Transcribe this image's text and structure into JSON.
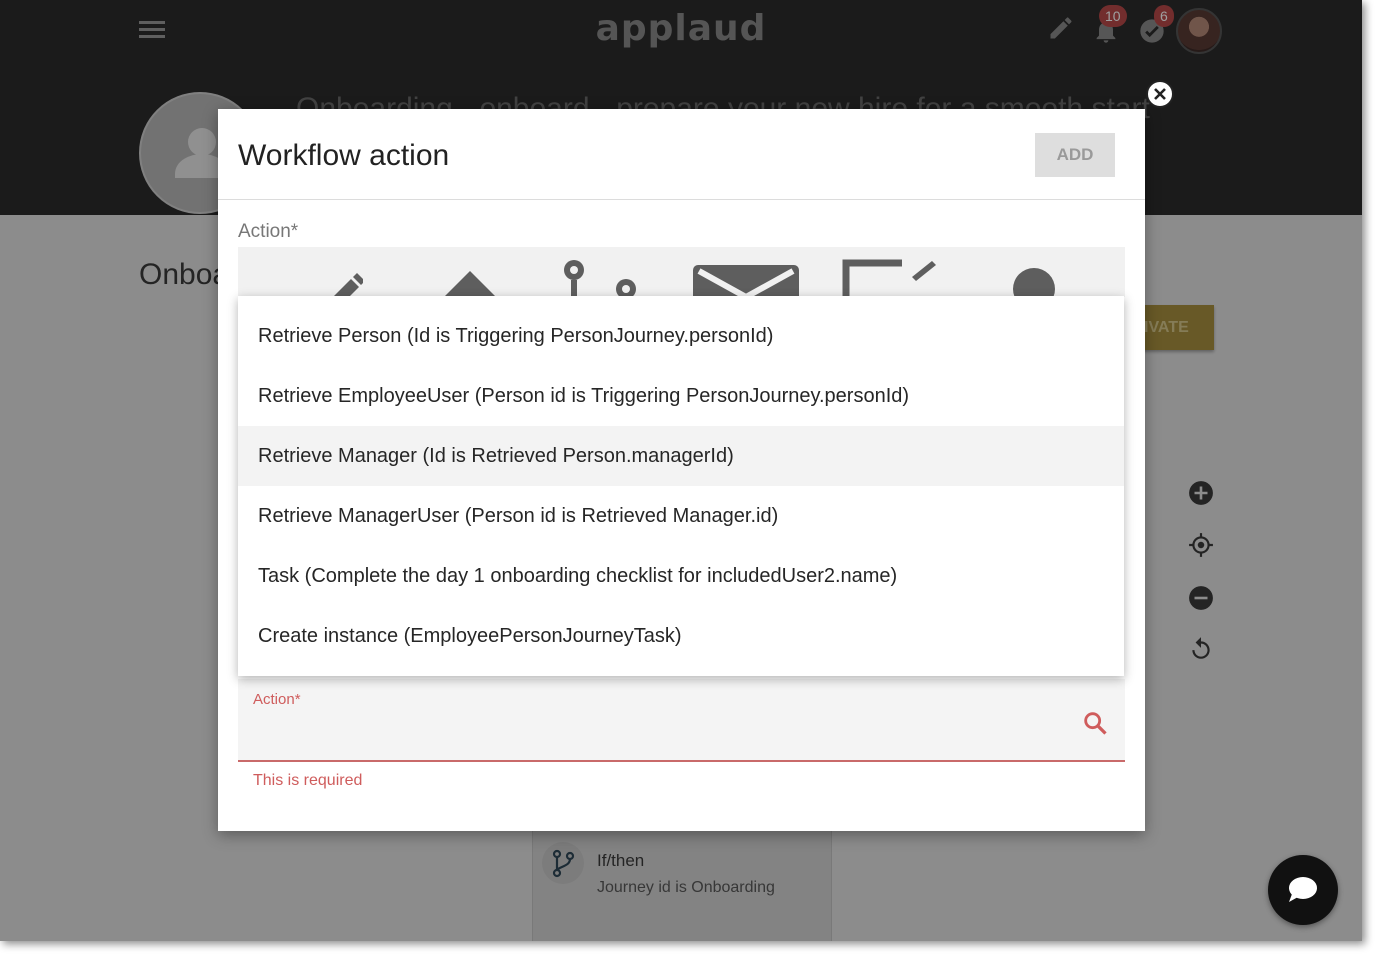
{
  "header": {
    "logo": "applaud",
    "notifications_count": "10",
    "tasks_count": "6"
  },
  "background": {
    "page_title": "Onboarding - onboard - prepare your new hire for a smooth start",
    "section_heading": "Onboa",
    "activate_label": "IVATE",
    "ifthen_title": "If/then",
    "ifthen_subtitle": "Journey id is Onboarding"
  },
  "modal": {
    "title": "Workflow action",
    "add_label": "ADD",
    "action_label": "Action*",
    "field_label": "Action*",
    "field_value": "",
    "error_text": "This is required"
  },
  "dropdown": {
    "items": [
      {
        "label": "Retrieve Person (Id is Triggering PersonJourney.personId)"
      },
      {
        "label": "Retrieve EmployeeUser (Person id is Triggering PersonJourney.personId)"
      },
      {
        "label": "Retrieve Manager (Id is Retrieved Person.managerId)"
      },
      {
        "label": "Retrieve ManagerUser (Person id is Retrieved Manager.id)"
      },
      {
        "label": "Task (Complete the day 1 onboarding checklist for includedUser2.name)"
      },
      {
        "label": "Create instance (EmployeePersonJourneyTask)"
      }
    ],
    "highlighted_index": 2
  },
  "colors": {
    "error": "#cf5c5c",
    "topbar": "#2d2d2d",
    "badge": "#b94a4a"
  }
}
